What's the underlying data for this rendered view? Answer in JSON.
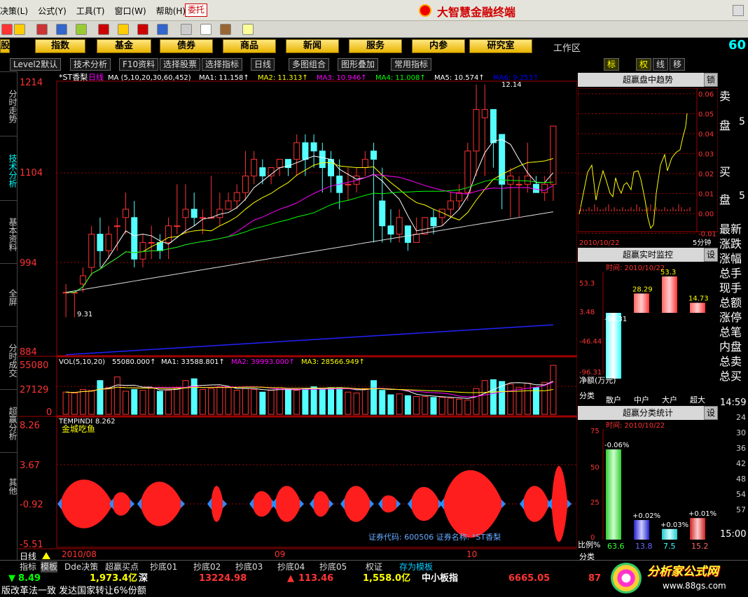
{
  "menubar": {
    "items": [
      "决策(L)",
      "公式(Y)",
      "工具(T)",
      "窗口(W)",
      "帮助(H)"
    ],
    "weituo": "委托",
    "brand": "大智慧金融终端"
  },
  "navbar": {
    "buttons": [
      "股",
      "指数",
      "基金",
      "债券",
      "商品",
      "新闻",
      "服务",
      "内参",
      "研究室"
    ],
    "workarea": "工作区",
    "right_tab_labels": [
      "标",
      "权",
      "线",
      "移"
    ],
    "right_num": "60"
  },
  "funcbar": {
    "buttons": [
      "Level2默认",
      "技术分析",
      "F10资料",
      "选择股票",
      "选择指标",
      "日线",
      "多图组合",
      "图形叠加",
      "常用指标"
    ]
  },
  "leftbar": {
    "tabs": [
      "分时走势",
      "技术分析",
      "基本资料",
      "全屏",
      "分时成交",
      "超赢分析",
      "其他"
    ]
  },
  "main_chart": {
    "stock_title": "*ST香梨",
    "period": "日线",
    "ma_header": "MA (5,10,20,30,60,452)",
    "ma_values": [
      {
        "label": "MA1: 11.158",
        "color": "#ffffff"
      },
      {
        "label": "MA2: 11.313",
        "color": "#ffff00"
      },
      {
        "label": "MA3: 10.946",
        "color": "#ff00ff"
      },
      {
        "label": "MA4: 11.008",
        "color": "#00ff00"
      },
      {
        "label": "MA5: 10.574",
        "color": "#ffffff"
      },
      {
        "label": "MA6: 9.253",
        "color": "#0000ff"
      }
    ],
    "y_ticks": [
      "1214",
      "1104",
      "994",
      "884"
    ],
    "hi_label": "12.14",
    "lo_label": "9.31",
    "vol_header": "VOL(5,10,20)",
    "vol_values": [
      {
        "label": "55080.000",
        "color": "#ffffff"
      },
      {
        "label": "MA1: 33588.801",
        "color": "#ffffff"
      },
      {
        "label": "MA2: 39993.000",
        "color": "#ff00ff"
      },
      {
        "label": "MA3: 28566.949",
        "color": "#ffff00"
      }
    ],
    "vol_ticks": [
      "55080",
      "27129",
      "0"
    ],
    "ind_header": "TEMPINDI",
    "ind_value": "8.262",
    "ind_name": "金城吃鱼",
    "ind_ticks": [
      "8.26",
      "3.67",
      "-0.92",
      "-5.51"
    ],
    "x_labels": [
      "2010/08",
      "09",
      "10"
    ],
    "info": "证券代码: 600506  证券名称: *ST香梨",
    "period_tab": "日线"
  },
  "chart_data": [
    {
      "type": "candlestick",
      "title": "*ST香梨 日线",
      "y_range": [
        8.84,
        12.14
      ],
      "candles": [
        [
          9.6,
          9.7,
          9.6,
          9.3
        ],
        [
          9.6,
          9.6,
          9.6,
          9.3
        ],
        [
          9.7,
          9.9,
          9.8,
          9.6
        ],
        [
          9.9,
          10.4,
          10.3,
          9.8
        ],
        [
          10.3,
          10.5,
          10.1,
          9.9
        ],
        [
          10.1,
          10.4,
          10.3,
          10.0
        ],
        [
          10.4,
          10.5,
          10.4,
          10.1
        ],
        [
          10.5,
          10.8,
          10.6,
          10.3
        ],
        [
          10.5,
          10.7,
          10.0,
          9.9
        ],
        [
          10.0,
          10.3,
          10.2,
          9.9
        ],
        [
          10.2,
          10.4,
          10.2,
          10.0
        ],
        [
          10.2,
          10.3,
          10.1,
          10.0
        ],
        [
          10.2,
          10.5,
          10.4,
          10.0
        ],
        [
          10.4,
          10.9,
          10.4,
          10.3
        ],
        [
          10.5,
          10.9,
          10.6,
          10.3
        ],
        [
          10.6,
          10.8,
          10.5,
          10.4
        ],
        [
          10.5,
          10.6,
          10.5,
          10.3
        ],
        [
          10.5,
          11.0,
          10.5,
          10.5
        ],
        [
          10.5,
          10.8,
          10.6,
          10.4
        ],
        [
          10.6,
          10.8,
          10.7,
          10.6
        ],
        [
          10.7,
          10.9,
          10.8,
          10.6
        ],
        [
          10.8,
          11.3,
          11.0,
          10.7
        ],
        [
          11.0,
          11.3,
          11.2,
          10.9
        ],
        [
          11.1,
          11.2,
          11.0,
          10.9
        ],
        [
          11.0,
          11.1,
          11.1,
          10.9
        ],
        [
          11.1,
          11.2,
          11.2,
          11.0
        ],
        [
          11.2,
          11.2,
          11.1,
          11.0
        ],
        [
          11.2,
          11.5,
          11.4,
          11.0
        ],
        [
          11.4,
          11.5,
          11.2,
          11.0
        ],
        [
          11.4,
          11.5,
          11.3,
          11.1
        ],
        [
          11.3,
          11.4,
          11.1,
          10.8
        ],
        [
          11.2,
          11.3,
          11.0,
          10.8
        ],
        [
          11.0,
          11.2,
          10.8,
          10.6
        ],
        [
          10.9,
          11.1,
          10.9,
          10.7
        ],
        [
          10.9,
          11.1,
          11.0,
          10.8
        ],
        [
          11.1,
          11.3,
          11.2,
          11.0
        ],
        [
          11.3,
          11.4,
          11.2,
          10.2
        ],
        [
          10.7,
          11.1,
          10.4,
          10.2
        ],
        [
          10.4,
          10.6,
          10.3,
          10.2
        ],
        [
          10.3,
          10.6,
          10.5,
          10.2
        ],
        [
          10.4,
          10.4,
          10.2,
          10.1
        ],
        [
          10.2,
          10.5,
          10.3,
          10.2
        ],
        [
          10.3,
          10.5,
          10.5,
          10.3
        ],
        [
          10.5,
          10.6,
          10.4,
          10.3
        ],
        [
          10.5,
          10.6,
          10.6,
          10.4
        ],
        [
          10.6,
          10.8,
          10.7,
          10.5
        ],
        [
          10.7,
          10.9,
          10.8,
          10.6
        ],
        [
          10.8,
          11.4,
          11.3,
          10.7
        ],
        [
          11.3,
          12.1,
          11.8,
          11.0
        ],
        [
          11.7,
          12.1,
          11.8,
          11.0
        ],
        [
          11.8,
          11.6,
          11.4,
          11.1
        ],
        [
          11.5,
          11.5,
          10.9,
          10.6
        ],
        [
          10.9,
          11.1,
          11.0,
          10.5
        ],
        [
          10.9,
          11.0,
          10.9,
          10.5
        ],
        [
          10.9,
          11.4,
          11.0,
          10.8
        ],
        [
          10.9,
          11.0,
          10.8,
          10.8
        ],
        [
          10.8,
          11.0,
          10.9,
          10.7
        ],
        [
          10.9,
          11.6,
          11.6,
          10.7
        ]
      ]
    },
    {
      "type": "bar",
      "title": "VOL(5,10,20)",
      "y_range": [
        0,
        55080
      ],
      "values": [
        25000,
        24000,
        28000,
        27000,
        38000,
        30000,
        42000,
        26000,
        28000,
        27000,
        30000,
        26000,
        27000,
        30000,
        38000,
        40000,
        28000,
        29000,
        31000,
        30000,
        27000,
        29000,
        28000,
        25000,
        27000,
        30000,
        29000,
        27000,
        29000,
        31000,
        29000,
        30000,
        30000,
        25000,
        24000,
        29000,
        38000,
        27000,
        22000,
        23000,
        21000,
        20000,
        20000,
        19000,
        19000,
        18000,
        17000,
        16000,
        29000,
        38000,
        39000,
        37000,
        34000,
        30000,
        35000,
        30000,
        36000,
        55080
      ]
    },
    {
      "type": "area",
      "title": "TEMPINDI 金城吃鱼",
      "y_range": [
        -5.51,
        8.26
      ]
    },
    {
      "type": "line",
      "title": "超赢盘中趋势",
      "x_label": "2010/10/22",
      "unit": "5分钟",
      "y_ticks": [
        "0.06",
        "0.05",
        "0.04",
        "0.03",
        "0.02",
        "0.01",
        "0.00",
        "-0.01"
      ]
    },
    {
      "type": "bar",
      "title": "超赢实时监控",
      "date": "时间: 2010/10/22",
      "categories": [
        "散户",
        "中户",
        "大户",
        "超大"
      ],
      "values": [
        -96.31,
        28.29,
        53.3,
        14.73
      ],
      "y_ticks": [
        "53.3",
        "3.48",
        "-46.44",
        "-96.31"
      ]
    },
    {
      "type": "bar",
      "title": "超赢分类统计",
      "date": "时间: 2010/10/22",
      "categories": [
        "散户",
        "中户",
        "大户",
        "超大"
      ],
      "pct_labels": [
        "-0.06%",
        "+0.02%",
        "+0.03%",
        "+0.01%"
      ],
      "values": [
        63.6,
        13.8,
        7.5,
        15.2
      ],
      "y_ticks": [
        "75",
        "50",
        "25",
        "0"
      ]
    }
  ],
  "rpanel": {
    "trend_title": "超赢盘中趋势",
    "trend_btn": "锁",
    "trend_date": "2010/10/22",
    "trend_unit": "5分钟",
    "monitor_title": "超赢实时监控",
    "monitor_btn": "设",
    "monitor_time": "时间: 2010/10/22",
    "net_label": "净额(万元)",
    "cat_label": "分类",
    "categories": [
      "散户",
      "中户",
      "大户",
      "超大"
    ],
    "stats_title": "超赢分类统计",
    "stats_btn": "设",
    "stats_time": "时间: 2010/10/22",
    "ratio_label": "比例%",
    "stats_values": [
      "63.6",
      "13.8",
      "7.5",
      "15.2"
    ],
    "bottom_label": "分类"
  },
  "farright": {
    "labels": [
      "卖",
      "盘",
      "买",
      "盘",
      "最新",
      "涨跌",
      "涨幅",
      "总手",
      "现手",
      "总额",
      "涨停",
      "总笔",
      "内盘",
      "总卖",
      "总买"
    ],
    "digits": [
      "5",
      "5"
    ],
    "time": "14:59",
    "end_time": "15:00",
    "times": [
      "24",
      "30",
      "36",
      "42",
      "48",
      "54",
      "57"
    ]
  },
  "bottombar": {
    "tabs": [
      "指标",
      "模板",
      "Dde决策",
      "超赢买点",
      "抄底01",
      "抄底02",
      "抄底03",
      "抄底04",
      "抄底05",
      "权证",
      "存为模板"
    ]
  },
  "ticker": {
    "v1": "8.49",
    "v2": "1,973.4亿",
    "v3": "深",
    "v4": "13224.98",
    "v5": "113.46",
    "v6": "1,558.0亿",
    "v7": "中小板指",
    "v8": "6665.05",
    "v9": "87"
  },
  "news": "版改革法一致 发达国家转让6%份额",
  "watermark": {
    "text": "分析家公式网",
    "url": "www.88gs.com"
  }
}
